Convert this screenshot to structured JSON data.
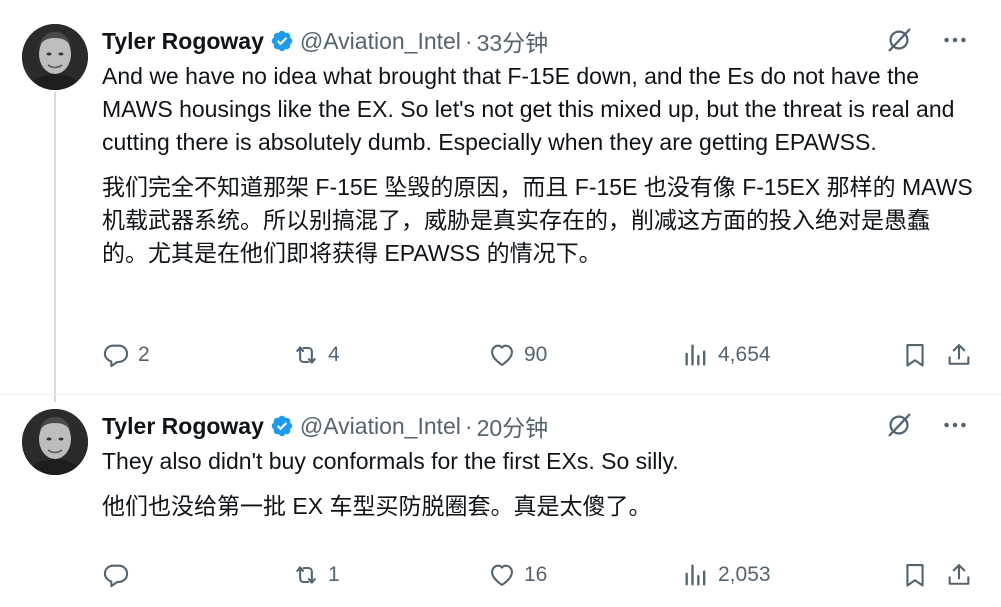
{
  "tweets": [
    {
      "author": {
        "name": "Tyler Rogoway",
        "handle": "@Aviation_Intel",
        "verified": true
      },
      "separator": "·",
      "time": "33分钟",
      "text_en": "And we have no idea what brought that F-15E down, and the Es do not have the MAWS housings like the EX. So let's not get this mixed up, but the threat is real and cutting there is absolutely dumb. Especially when they are getting EPAWSS.",
      "text_zh": "我们完全不知道那架 F-15E 坠毁的原因，而且 F-15E 也没有像 F-15EX 那样的 MAWS 机载武器系统。所以别搞混了，威胁是真实存在的，削减这方面的投入绝对是愚蠢的。尤其是在他们即将获得 EPAWSS 的情况下。",
      "stats": {
        "replies": "2",
        "retweets": "4",
        "likes": "90",
        "views": "4,654"
      }
    },
    {
      "author": {
        "name": "Tyler Rogoway",
        "handle": "@Aviation_Intel",
        "verified": true
      },
      "separator": "·",
      "time": "20分钟",
      "text_en": "They also didn't buy conformals for the first EXs. So silly.",
      "text_zh": "他们也没给第一批 EX 车型买防脱圈套。真是太傻了。",
      "stats": {
        "replies": "",
        "retweets": "1",
        "likes": "16",
        "views": "2,053"
      }
    }
  ],
  "icons": {
    "verified": "verified-badge-icon",
    "grok": "grok-slash-icon",
    "more": "more-dots-icon",
    "reply": "reply-bubble-icon",
    "retweet": "retweet-icon",
    "like": "heart-icon",
    "views": "bar-chart-icon",
    "bookmark": "bookmark-icon",
    "share": "share-upload-icon"
  },
  "colors": {
    "text": "#0f1419",
    "secondary": "#536471",
    "verified": "#1d9bf0",
    "thread_line": "#cfd9de"
  }
}
